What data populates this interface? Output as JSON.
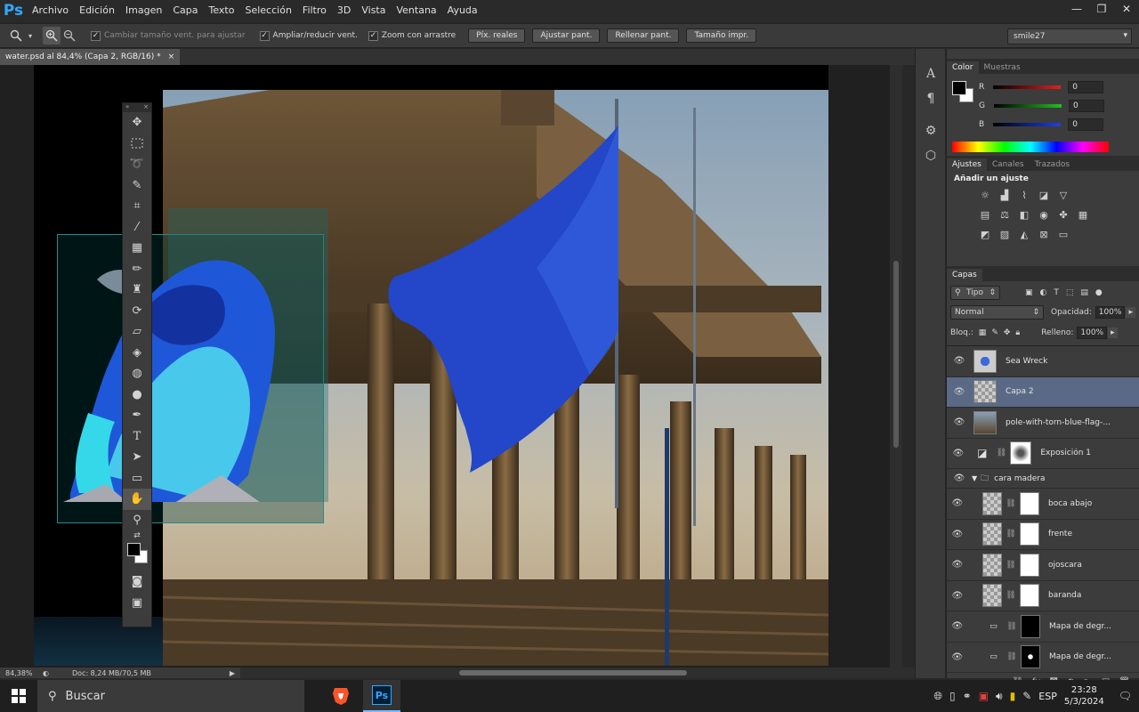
{
  "app": {
    "logo": "Ps"
  },
  "menu": [
    "Archivo",
    "Edición",
    "Imagen",
    "Capa",
    "Texto",
    "Selección",
    "Filtro",
    "3D",
    "Vista",
    "Ventana",
    "Ayuda"
  ],
  "window_controls": {
    "minimize": "—",
    "restore": "❐",
    "close": "✕"
  },
  "options": {
    "resize_windows": "Cambiar tamaño vent. para ajustar",
    "zoom_all": "Ampliar/reducir vent.",
    "scrubby_zoom": "Zoom con arrastre",
    "actual_pixels": "Píx. reales",
    "fit_screen": "Ajustar pant.",
    "fill_screen": "Rellenar pant.",
    "print_size": "Tamaño impr.",
    "workspace": "smile27"
  },
  "document": {
    "tab_title": "water.psd al 84,4% (Capa 2, RGB/16) *",
    "close": "×"
  },
  "status": {
    "zoom": "84,38%",
    "doc_info": "Doc: 8,24 MB/70,5 MB"
  },
  "color_panel": {
    "tabs": [
      "Color",
      "Muestras"
    ],
    "channels": [
      {
        "label": "R",
        "value": "0",
        "color": "#e02020"
      },
      {
        "label": "G",
        "value": "0",
        "color": "#20c020"
      },
      {
        "label": "B",
        "value": "0",
        "color": "#2040e0"
      }
    ]
  },
  "adjustments": {
    "tabs": [
      "Ajustes",
      "Canales",
      "Trazados"
    ],
    "title": "Añadir un ajuste"
  },
  "layers": {
    "tab": "Capas",
    "filter": "Tipo",
    "blend_mode": "Normal",
    "opacity_label": "Opacidad:",
    "opacity": "100%",
    "lock_label": "Bloq.:",
    "fill_label": "Relleno:",
    "fill": "100%",
    "items": [
      {
        "name": "Sea Wreck",
        "type": "smart"
      },
      {
        "name": "Capa 2",
        "type": "pixel",
        "selected": true
      },
      {
        "name": "pole-with-torn-blue-flag-per...",
        "type": "smart"
      },
      {
        "name": "Exposición 1",
        "type": "adjustment"
      },
      {
        "name": "cara madera",
        "type": "group"
      },
      {
        "name": "boca abajo",
        "type": "masked"
      },
      {
        "name": "frente",
        "type": "masked"
      },
      {
        "name": "ojoscara",
        "type": "masked"
      },
      {
        "name": "baranda",
        "type": "masked"
      },
      {
        "name": "Mapa de degr...",
        "type": "gradientmap"
      },
      {
        "name": "Mapa de degr...",
        "type": "gradientmap"
      }
    ]
  },
  "taskbar": {
    "search": "Buscar",
    "lang": "ESP",
    "time": "23:28",
    "date": "5/3/2024"
  },
  "accent": "#31a8ff"
}
